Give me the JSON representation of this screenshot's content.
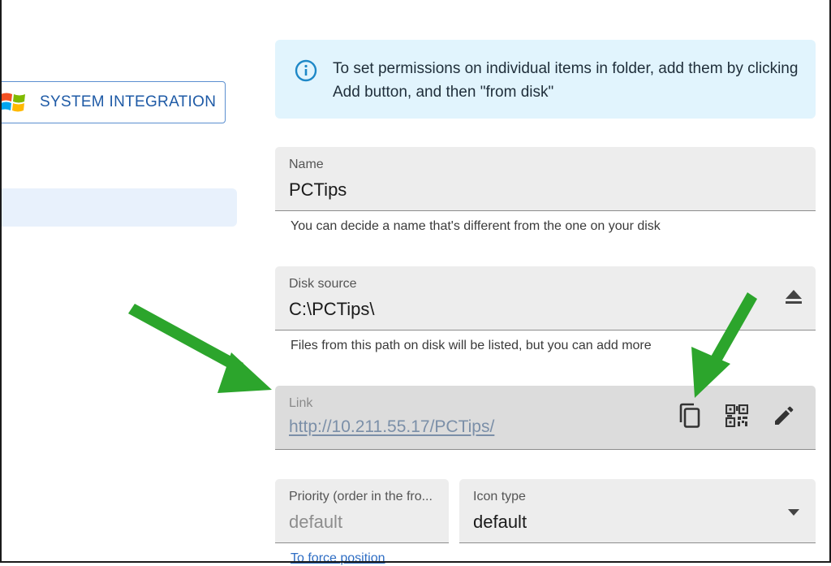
{
  "sidebar": {
    "system_integration_label": "SYSTEM INTEGRATION"
  },
  "info": {
    "text": "To set permissions on individual items in folder, add them by clicking Add button, and then \"from disk\""
  },
  "form": {
    "name": {
      "label": "Name",
      "value": "PCTips",
      "helper": "You can decide a name that's different from the one on your disk"
    },
    "disk_source": {
      "label": "Disk source",
      "value": "C:\\PCTips\\",
      "helper": "Files from this path on disk will be listed, but you can add more"
    },
    "link": {
      "label": "Link",
      "value": "http://10.211.55.17/PCTips/"
    },
    "priority": {
      "label": "Priority (order in the fro...",
      "placeholder": "default"
    },
    "icon_type": {
      "label": "Icon type",
      "value": "default"
    },
    "force_position_link": "To force position"
  },
  "icons": {
    "info": "info-icon",
    "eject": "eject-icon",
    "copy": "copy-icon",
    "qr": "qr-code-icon",
    "edit": "pencil-icon",
    "dropdown": "triangle-down-icon",
    "windows": "windows-logo-icon"
  },
  "colors": {
    "accent": "#1e5aa6",
    "info_bg": "#e1f4fd",
    "field_bg": "#ededed",
    "link_field_bg": "#dcdcdc",
    "annotation_arrow": "#2ca52c"
  }
}
